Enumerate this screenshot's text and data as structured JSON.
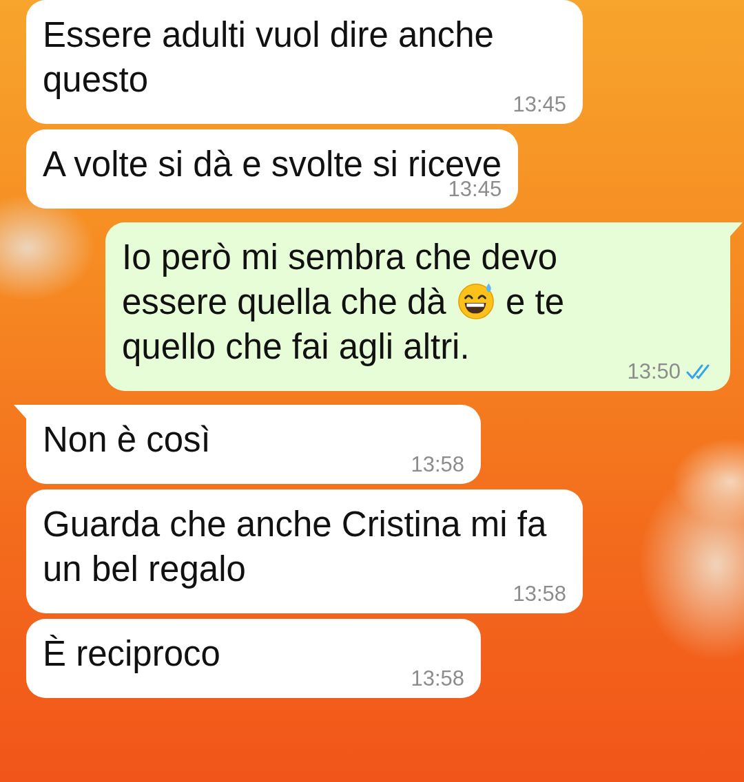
{
  "messages": [
    {
      "kind": "incoming",
      "tail": false,
      "segments": [
        {
          "kind": "text",
          "text": "Essere adulti vuol dire anche questo"
        }
      ],
      "time": "13:45"
    },
    {
      "kind": "incoming",
      "tail": false,
      "segments": [
        {
          "kind": "text",
          "text": "A volte si dà e svolte si riceve"
        }
      ],
      "time": "13:45"
    },
    {
      "kind": "outgoing",
      "tail": true,
      "segments": [
        {
          "kind": "text",
          "text": "Io però mi sembra che devo essere quella che dà "
        },
        {
          "kind": "emoji"
        },
        {
          "kind": "text",
          "text": " e te quello che fai agli altri."
        }
      ],
      "time": "13:50",
      "read": true
    },
    {
      "kind": "incoming",
      "tail": true,
      "segments": [
        {
          "kind": "text",
          "text": "Non è così"
        }
      ],
      "time": "13:58"
    },
    {
      "kind": "incoming",
      "tail": false,
      "segments": [
        {
          "kind": "text",
          "text": "Guarda che anche Cristina mi fa un bel regalo"
        }
      ],
      "time": "13:58"
    },
    {
      "kind": "incoming",
      "tail": false,
      "segments": [
        {
          "kind": "text",
          "text": "È reciproco"
        }
      ],
      "time": "13:58"
    }
  ]
}
